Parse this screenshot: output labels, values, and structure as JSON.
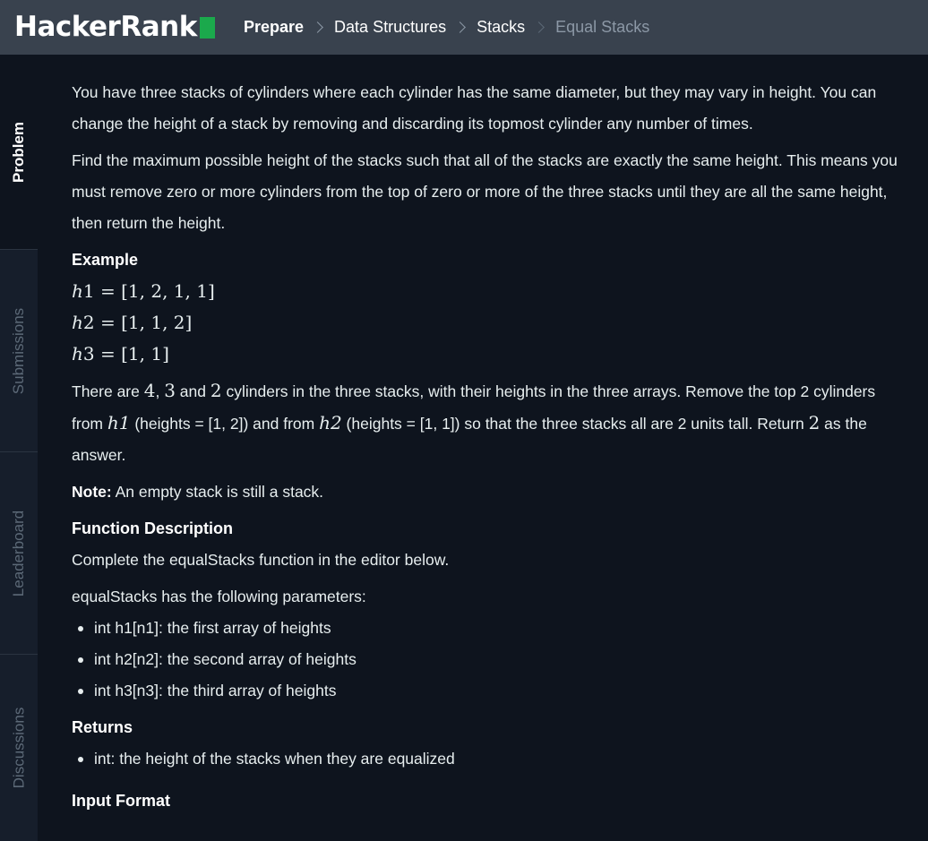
{
  "header": {
    "logo_text": "HackerRank",
    "breadcrumb": [
      "Prepare",
      "Data Structures",
      "Stacks",
      "Equal Stacks"
    ]
  },
  "sidebar": {
    "tabs": [
      "Problem",
      "Submissions",
      "Leaderboard",
      "Discussions"
    ]
  },
  "problem": {
    "intro": "You have three stacks of cylinders where each cylinder has the same diameter, but they may vary in height. You can change the height of a stack by removing and discarding its topmost cylinder any number of times.",
    "task": "Find the maximum possible height of the stacks such that all of the stacks are exactly the same height. This means you must remove zero or more cylinders from the top of zero or more of the three stacks until they are all the same height, then return the height.",
    "example_heading": "Example",
    "example_lines": [
      {
        "var": "h",
        "sub": "1",
        "value": "[1, 2, 1, 1]"
      },
      {
        "var": "h",
        "sub": "2",
        "value": "[1, 1, 2]"
      },
      {
        "var": "h",
        "sub": "3",
        "value": "[1, 1]"
      }
    ],
    "explanation": {
      "p1": "There are ",
      "n1": "4",
      "p2": ", ",
      "n2": "3",
      "p3": " and ",
      "n3": "2",
      "p4": " cylinders in the three stacks, with their heights in the three arrays. Remove the top 2 cylinders from ",
      "v1": "h1",
      "p5": " (heights = [1, 2]) and from ",
      "v2": "h2",
      "p6": " (heights = [1, 1]) so that the three stacks all are 2 units tall. Return ",
      "n4": "2",
      "p7": " as the answer."
    },
    "note_label": "Note:",
    "note_text": " An empty stack is still a stack.",
    "function_heading": "Function Description",
    "function_text": "Complete the equalStacks function in the editor below.",
    "params_intro": "equalStacks has the following parameters:",
    "params": [
      "int h1[n1]: the first array of heights",
      "int h2[n2]: the second array of heights",
      "int h3[n3]: the third array of heights"
    ],
    "returns_heading": "Returns",
    "returns": [
      "int: the height of the stacks when they are equalized"
    ],
    "input_heading": "Input Format"
  }
}
